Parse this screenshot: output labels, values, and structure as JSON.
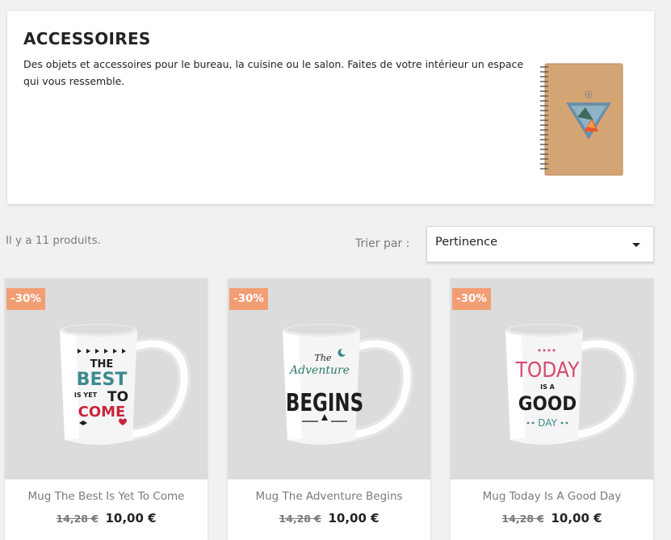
{
  "category": {
    "title": "ACCESSOIRES",
    "description": "Des objets et accessoires pour le bureau, la cuisine ou le salon. Faites de votre intérieur un espace qui vous ressemble."
  },
  "listing": {
    "count_text": "Il y a 11 produits.",
    "sort_label": "Trier par :",
    "sort_value": "Pertinence"
  },
  "products": [
    {
      "name": "Mug The Best Is Yet To Come",
      "badge": "-30%",
      "old_price": "14,28 €",
      "price": "10,00 €",
      "print": {
        "l1": "THE",
        "l2": "BEST",
        "l3a": "IS YET",
        "l3b": "TO",
        "l4": "COME"
      }
    },
    {
      "name": "Mug The Adventure Begins",
      "badge": "-30%",
      "old_price": "14,28 €",
      "price": "10,00 €",
      "print": {
        "l1": "The",
        "l2": "Adventure",
        "l3": "BEGINS"
      }
    },
    {
      "name": "Mug Today Is A Good Day",
      "badge": "-30%",
      "old_price": "14,28 €",
      "price": "10,00 €",
      "print": {
        "l1": "TODAY",
        "l2": "IS A",
        "l3": "GOOD",
        "l4": "DAY"
      }
    }
  ],
  "colors": {
    "badge": "#f39d72",
    "teal": "#3b8a8e",
    "red": "#c8253a",
    "pink": "#d64a70",
    "dark": "#1e1e1e"
  }
}
